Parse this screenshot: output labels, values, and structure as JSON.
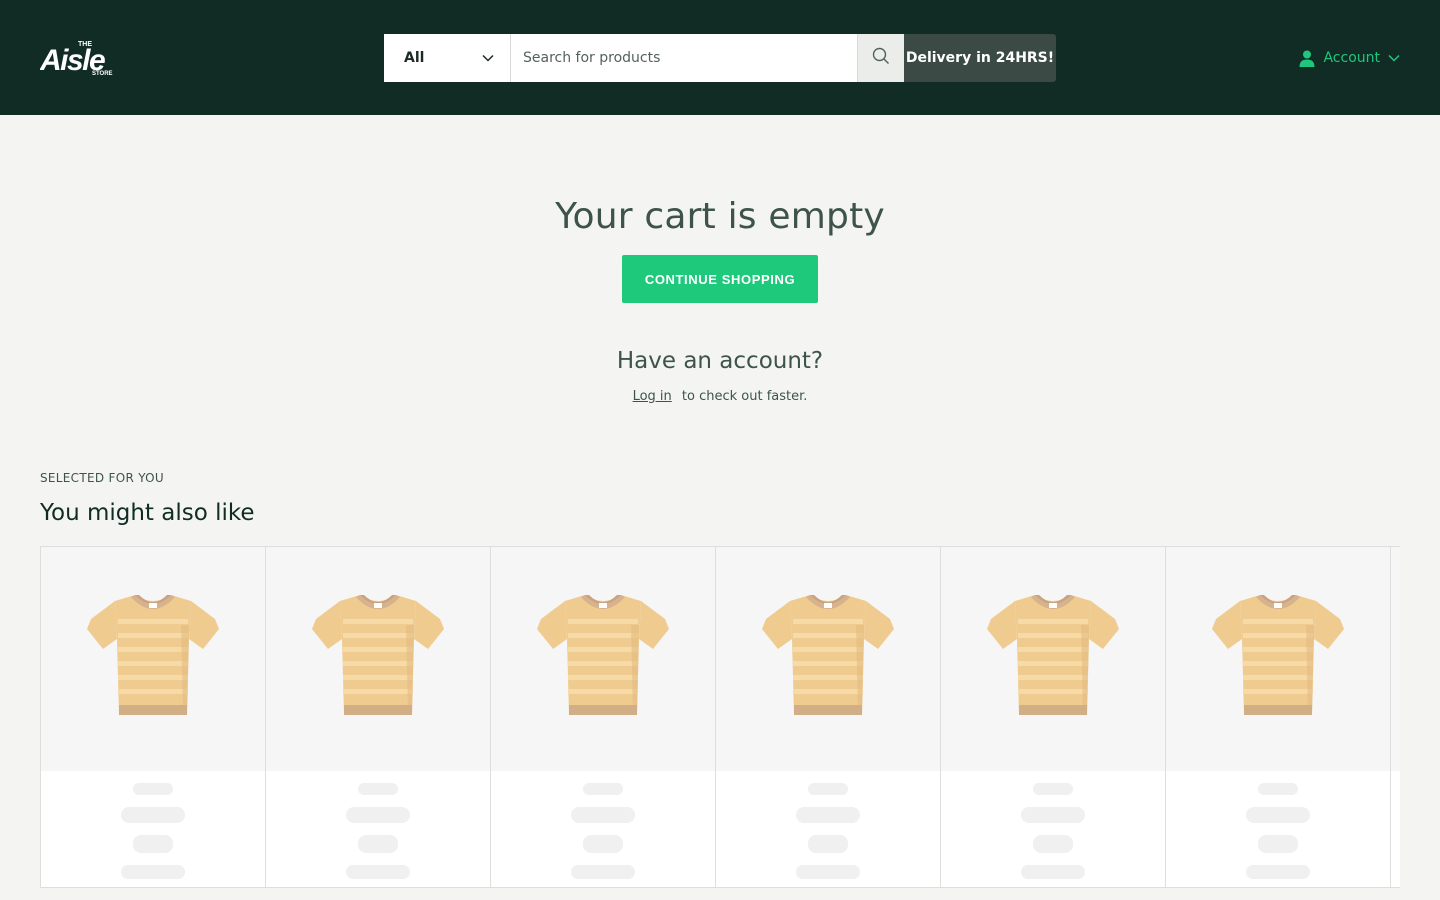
{
  "header": {
    "logo_text": "The Aisle Store",
    "search": {
      "category_selected": "All",
      "placeholder": "Search for products",
      "value": ""
    },
    "delivery_badge": "Delivery in 24HRS!",
    "account_label": "Account"
  },
  "cart": {
    "empty_title": "Your cart is empty",
    "continue_label": "CONTINUE SHOPPING",
    "account_heading": "Have an account?",
    "login_link": "Log in",
    "login_suffix": "to check out faster."
  },
  "recommendations": {
    "eyebrow": "SELECTED FOR YOU",
    "title": "You might also like",
    "products": [
      {
        "image": "striped-tshirt-icon"
      },
      {
        "image": "striped-tshirt-icon"
      },
      {
        "image": "striped-tshirt-icon"
      },
      {
        "image": "striped-tshirt-icon"
      },
      {
        "image": "striped-tshirt-icon"
      },
      {
        "image": "striped-tshirt-icon"
      },
      {
        "image": "striped-tshirt-icon"
      }
    ]
  },
  "colors": {
    "header_bg": "#102c25",
    "accent_green": "#1ec97c",
    "delivery_bg": "#3b4a45",
    "text": "#3e5448"
  }
}
